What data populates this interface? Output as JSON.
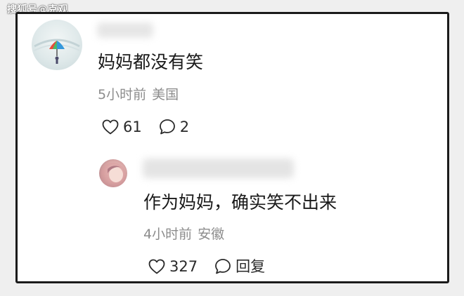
{
  "watermark": "搜狐号@克观",
  "comments": [
    {
      "text": "妈妈都没有笑",
      "time": "5小时前",
      "location": "美国",
      "likes": "61",
      "reply_label": "2"
    },
    {
      "text": "作为妈妈，确实笑不出来",
      "time": "4小时前",
      "location": "安徽",
      "likes": "327",
      "reply_label": "回复"
    }
  ],
  "icons": {
    "like": "heart-outline-icon",
    "reply": "speech-bubble-icon"
  },
  "colors": {
    "frame_border": "#1b1b1b",
    "meta_text": "#8c8c8c",
    "body_text": "#1a1a1a"
  }
}
